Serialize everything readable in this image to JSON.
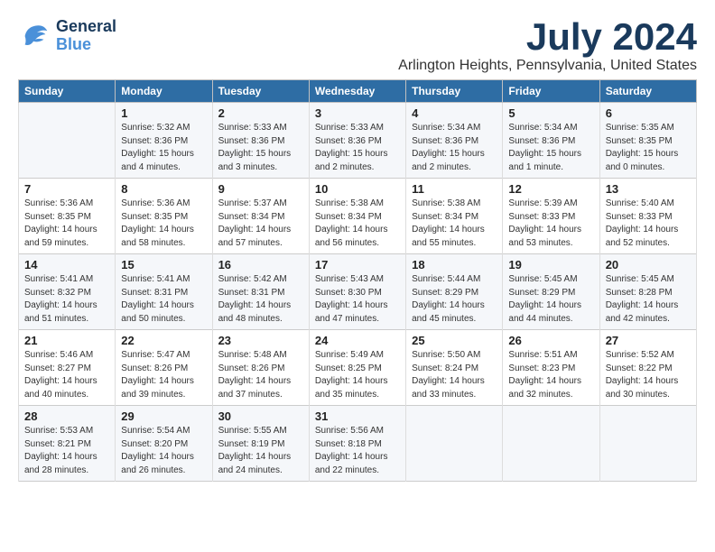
{
  "header": {
    "logo_general": "General",
    "logo_blue": "Blue",
    "month_title": "July 2024",
    "location": "Arlington Heights, Pennsylvania, United States"
  },
  "days_of_week": [
    "Sunday",
    "Monday",
    "Tuesday",
    "Wednesday",
    "Thursday",
    "Friday",
    "Saturday"
  ],
  "weeks": [
    [
      {
        "day": "",
        "info": ""
      },
      {
        "day": "1",
        "info": "Sunrise: 5:32 AM\nSunset: 8:36 PM\nDaylight: 15 hours\nand 4 minutes."
      },
      {
        "day": "2",
        "info": "Sunrise: 5:33 AM\nSunset: 8:36 PM\nDaylight: 15 hours\nand 3 minutes."
      },
      {
        "day": "3",
        "info": "Sunrise: 5:33 AM\nSunset: 8:36 PM\nDaylight: 15 hours\nand 2 minutes."
      },
      {
        "day": "4",
        "info": "Sunrise: 5:34 AM\nSunset: 8:36 PM\nDaylight: 15 hours\nand 2 minutes."
      },
      {
        "day": "5",
        "info": "Sunrise: 5:34 AM\nSunset: 8:36 PM\nDaylight: 15 hours\nand 1 minute."
      },
      {
        "day": "6",
        "info": "Sunrise: 5:35 AM\nSunset: 8:35 PM\nDaylight: 15 hours\nand 0 minutes."
      }
    ],
    [
      {
        "day": "7",
        "info": "Sunrise: 5:36 AM\nSunset: 8:35 PM\nDaylight: 14 hours\nand 59 minutes."
      },
      {
        "day": "8",
        "info": "Sunrise: 5:36 AM\nSunset: 8:35 PM\nDaylight: 14 hours\nand 58 minutes."
      },
      {
        "day": "9",
        "info": "Sunrise: 5:37 AM\nSunset: 8:34 PM\nDaylight: 14 hours\nand 57 minutes."
      },
      {
        "day": "10",
        "info": "Sunrise: 5:38 AM\nSunset: 8:34 PM\nDaylight: 14 hours\nand 56 minutes."
      },
      {
        "day": "11",
        "info": "Sunrise: 5:38 AM\nSunset: 8:34 PM\nDaylight: 14 hours\nand 55 minutes."
      },
      {
        "day": "12",
        "info": "Sunrise: 5:39 AM\nSunset: 8:33 PM\nDaylight: 14 hours\nand 53 minutes."
      },
      {
        "day": "13",
        "info": "Sunrise: 5:40 AM\nSunset: 8:33 PM\nDaylight: 14 hours\nand 52 minutes."
      }
    ],
    [
      {
        "day": "14",
        "info": "Sunrise: 5:41 AM\nSunset: 8:32 PM\nDaylight: 14 hours\nand 51 minutes."
      },
      {
        "day": "15",
        "info": "Sunrise: 5:41 AM\nSunset: 8:31 PM\nDaylight: 14 hours\nand 50 minutes."
      },
      {
        "day": "16",
        "info": "Sunrise: 5:42 AM\nSunset: 8:31 PM\nDaylight: 14 hours\nand 48 minutes."
      },
      {
        "day": "17",
        "info": "Sunrise: 5:43 AM\nSunset: 8:30 PM\nDaylight: 14 hours\nand 47 minutes."
      },
      {
        "day": "18",
        "info": "Sunrise: 5:44 AM\nSunset: 8:29 PM\nDaylight: 14 hours\nand 45 minutes."
      },
      {
        "day": "19",
        "info": "Sunrise: 5:45 AM\nSunset: 8:29 PM\nDaylight: 14 hours\nand 44 minutes."
      },
      {
        "day": "20",
        "info": "Sunrise: 5:45 AM\nSunset: 8:28 PM\nDaylight: 14 hours\nand 42 minutes."
      }
    ],
    [
      {
        "day": "21",
        "info": "Sunrise: 5:46 AM\nSunset: 8:27 PM\nDaylight: 14 hours\nand 40 minutes."
      },
      {
        "day": "22",
        "info": "Sunrise: 5:47 AM\nSunset: 8:26 PM\nDaylight: 14 hours\nand 39 minutes."
      },
      {
        "day": "23",
        "info": "Sunrise: 5:48 AM\nSunset: 8:26 PM\nDaylight: 14 hours\nand 37 minutes."
      },
      {
        "day": "24",
        "info": "Sunrise: 5:49 AM\nSunset: 8:25 PM\nDaylight: 14 hours\nand 35 minutes."
      },
      {
        "day": "25",
        "info": "Sunrise: 5:50 AM\nSunset: 8:24 PM\nDaylight: 14 hours\nand 33 minutes."
      },
      {
        "day": "26",
        "info": "Sunrise: 5:51 AM\nSunset: 8:23 PM\nDaylight: 14 hours\nand 32 minutes."
      },
      {
        "day": "27",
        "info": "Sunrise: 5:52 AM\nSunset: 8:22 PM\nDaylight: 14 hours\nand 30 minutes."
      }
    ],
    [
      {
        "day": "28",
        "info": "Sunrise: 5:53 AM\nSunset: 8:21 PM\nDaylight: 14 hours\nand 28 minutes."
      },
      {
        "day": "29",
        "info": "Sunrise: 5:54 AM\nSunset: 8:20 PM\nDaylight: 14 hours\nand 26 minutes."
      },
      {
        "day": "30",
        "info": "Sunrise: 5:55 AM\nSunset: 8:19 PM\nDaylight: 14 hours\nand 24 minutes."
      },
      {
        "day": "31",
        "info": "Sunrise: 5:56 AM\nSunset: 8:18 PM\nDaylight: 14 hours\nand 22 minutes."
      },
      {
        "day": "",
        "info": ""
      },
      {
        "day": "",
        "info": ""
      },
      {
        "day": "",
        "info": ""
      }
    ]
  ]
}
